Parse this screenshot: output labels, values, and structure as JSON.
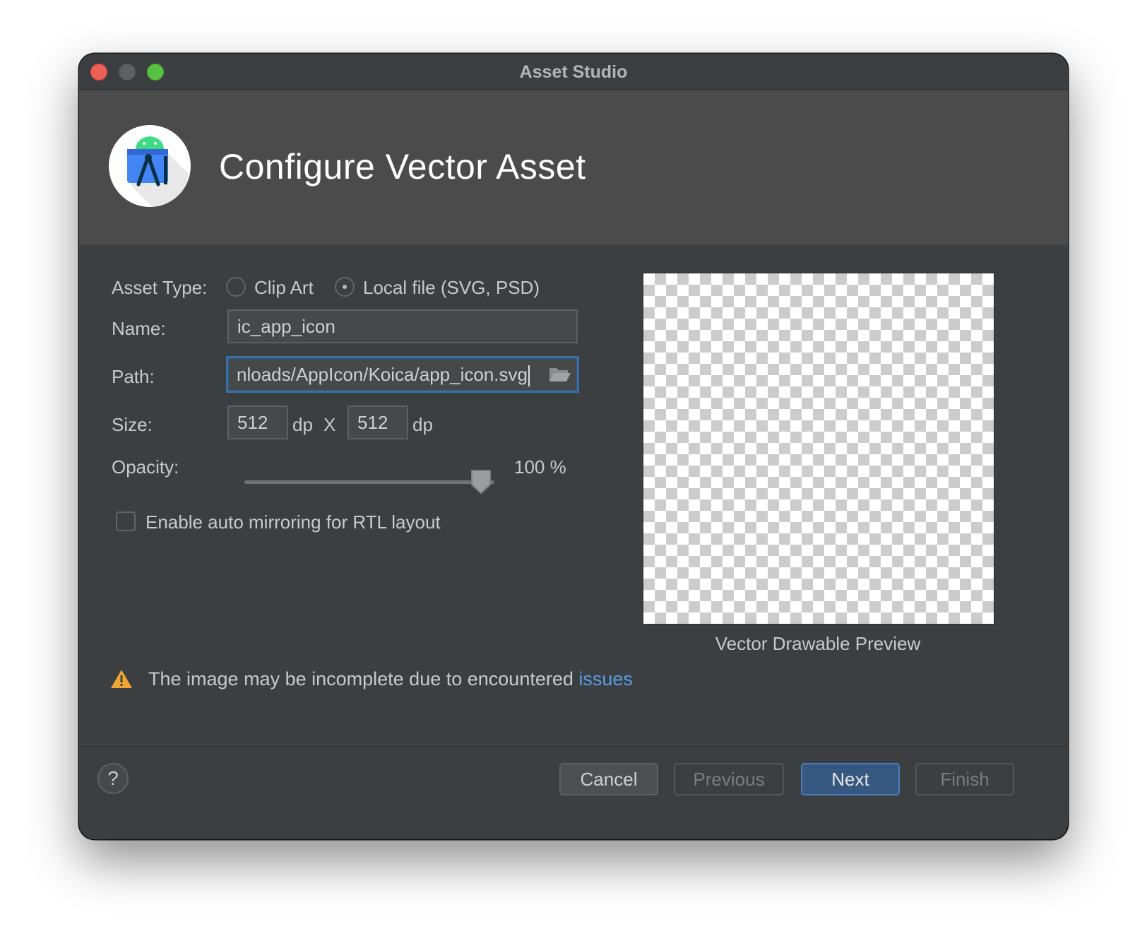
{
  "window": {
    "title": "Asset Studio"
  },
  "header": {
    "title": "Configure Vector Asset",
    "logo_icon": "android-studio-icon"
  },
  "form": {
    "asset_type": {
      "label": "Asset Type:",
      "options": [
        "Clip Art",
        "Local file (SVG, PSD)"
      ],
      "selected": "Local file (SVG, PSD)"
    },
    "name": {
      "label": "Name:",
      "value": "ic_app_icon"
    },
    "path": {
      "label": "Path:",
      "value": "nloads/AppIcon/Koica/app_icon.svg",
      "browse_icon": "folder-open-icon"
    },
    "size": {
      "label": "Size:",
      "width": "512",
      "height": "512",
      "unit": "dp",
      "separator": "X"
    },
    "opacity": {
      "label": "Opacity:",
      "value_percent": 100,
      "value_text": "100 %"
    },
    "auto_mirror": {
      "label": "Enable auto mirroring for RTL layout",
      "checked": false
    }
  },
  "preview": {
    "caption": "Vector Drawable Preview"
  },
  "warning": {
    "icon": "warning-icon",
    "text": "The image may be incomplete due to encountered ",
    "link": "issues"
  },
  "footer": {
    "help": "?",
    "cancel": "Cancel",
    "previous": "Previous",
    "next": "Next",
    "finish": "Finish"
  },
  "colors": {
    "background": "#3c3f41",
    "header": "#4b4b4b",
    "primary_button": "#365880",
    "focus_border": "#3c6ea4",
    "link": "#5a9ee8",
    "warning": "#f0a732"
  }
}
